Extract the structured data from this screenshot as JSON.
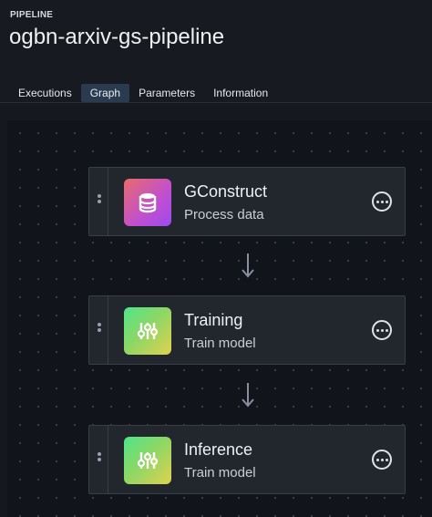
{
  "header": {
    "eyebrow": "PIPELINE",
    "title": "ogbn-arxiv-gs-pipeline"
  },
  "tabs": [
    {
      "label": "Executions",
      "active": false
    },
    {
      "label": "Graph",
      "active": true
    },
    {
      "label": "Parameters",
      "active": false
    },
    {
      "label": "Information",
      "active": false
    }
  ],
  "nodes": [
    {
      "name": "GConstruct",
      "subtitle": "Process data",
      "icon": "database-icon",
      "badge_color": "#c04fd0"
    },
    {
      "name": "Training",
      "subtitle": "Train model",
      "icon": "sliders-icon",
      "badge_color": "#8bd766"
    },
    {
      "name": "Inference",
      "subtitle": "Train model",
      "icon": "sliders-icon",
      "badge_color": "#8bd766"
    }
  ],
  "colors": {
    "background": "#15181e",
    "node_bg": "#22262d",
    "active_tab": "#2a3a4f"
  }
}
